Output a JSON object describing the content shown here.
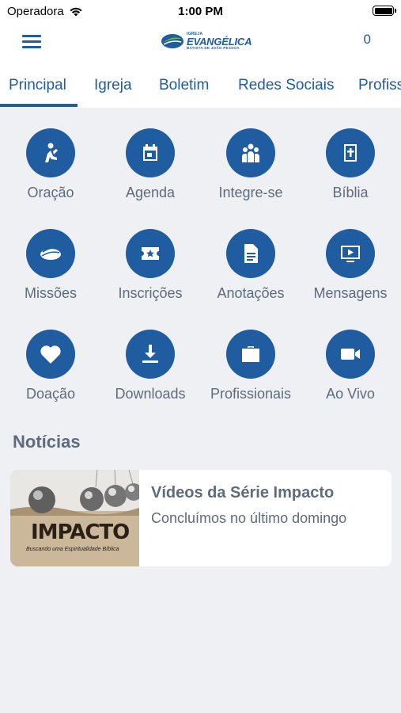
{
  "status_bar": {
    "carrier": "Operadora",
    "time": "1:00 PM"
  },
  "header": {
    "logo_small": "IGREJA",
    "logo_big": "EVANGÉLICA",
    "logo_sub": "BATISTA DE JOÃO PESSOA",
    "counter": "0"
  },
  "tabs": [
    "Principal",
    "Igreja",
    "Boletim",
    "Redes Sociais",
    "Profissionais"
  ],
  "grid": [
    {
      "label": "Oração",
      "icon": "praying-icon"
    },
    {
      "label": "Agenda",
      "icon": "calendar-icon"
    },
    {
      "label": "Integre-se",
      "icon": "group-icon"
    },
    {
      "label": "Bíblia",
      "icon": "bible-icon"
    },
    {
      "label": "Missões",
      "icon": "globe-icon"
    },
    {
      "label": "Inscrições",
      "icon": "ticket-icon"
    },
    {
      "label": "Anotações",
      "icon": "note-icon"
    },
    {
      "label": "Mensagens",
      "icon": "video-play-icon"
    },
    {
      "label": "Doação",
      "icon": "heart-icon"
    },
    {
      "label": "Downloads",
      "icon": "download-icon"
    },
    {
      "label": "Profissionais",
      "icon": "briefcase-icon"
    },
    {
      "label": "Ao Vivo",
      "icon": "video-camera-icon"
    }
  ],
  "news": {
    "section_title": "Notícias",
    "items": [
      {
        "title": "Vídeos da Série Impacto",
        "excerpt": "Concluímos no último domingo",
        "thumb_title": "IMPACTO",
        "thumb_subtitle": "Buscando uma Espiritualidade Bíblica"
      }
    ]
  },
  "colors": {
    "primary": "#1f5ca0",
    "text": "#5e6b7d",
    "background": "#eef0f3"
  }
}
